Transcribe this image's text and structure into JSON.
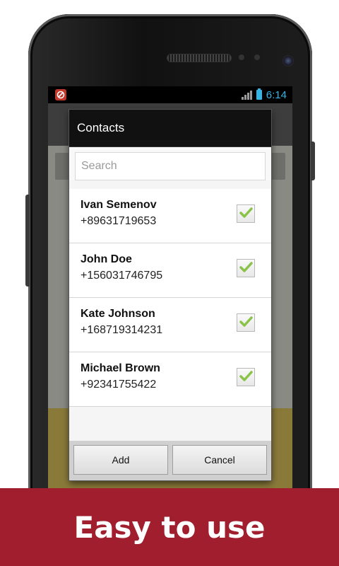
{
  "status_bar": {
    "time": "6:14"
  },
  "dialog": {
    "title": "Contacts",
    "search": {
      "placeholder": "Search",
      "value": ""
    },
    "contacts": [
      {
        "name": "Ivan Semenov",
        "phone": "+89631719653",
        "checked": true
      },
      {
        "name": "John Doe",
        "phone": "+156031746795",
        "checked": true
      },
      {
        "name": "Kate Johnson",
        "phone": "+168719314231",
        "checked": true
      },
      {
        "name": "Michael Brown",
        "phone": "+92341755422",
        "checked": true
      }
    ],
    "buttons": {
      "add": "Add",
      "cancel": "Cancel"
    }
  },
  "colors": {
    "accent": "#33b5e5",
    "check": "#8bc34a",
    "banner": "#a01e2e"
  },
  "banner": {
    "text": "Easy to use"
  }
}
